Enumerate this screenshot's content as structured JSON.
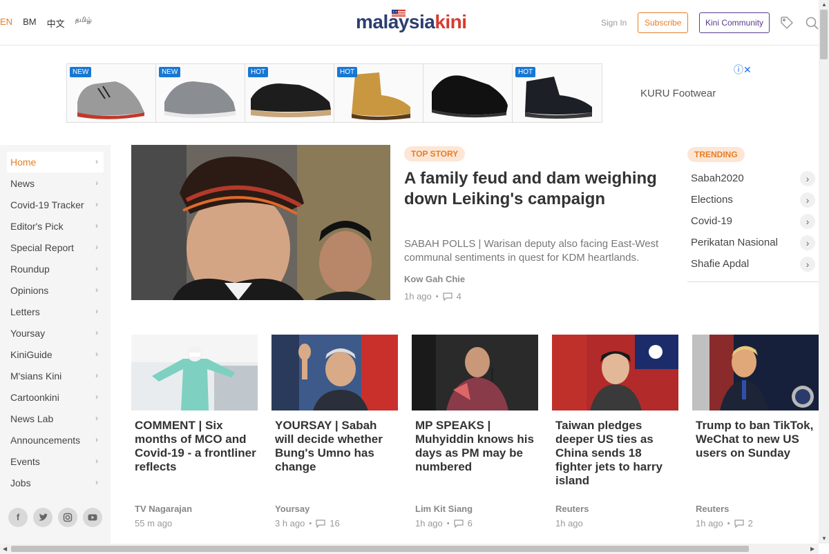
{
  "header": {
    "languages": [
      "EN",
      "BM",
      "中文",
      "தமிழ்"
    ],
    "logo_part1": "malaysia",
    "logo_part2": "kini",
    "sign_in": "Sign In",
    "subscribe": "Subscribe",
    "community": "Kini Community"
  },
  "ad": {
    "badges": [
      "NEW",
      "NEW",
      "HOT",
      "HOT",
      "",
      "HOT"
    ],
    "brand": "KURU Footwear"
  },
  "sidebar": {
    "items": [
      "Home",
      "News",
      "Covid-19 Tracker",
      "Editor's Pick",
      "Special Report",
      "Roundup",
      "Opinions",
      "Letters",
      "Yoursay",
      "KiniGuide",
      "M'sians Kini",
      "Cartoonkini",
      "News Lab",
      "Announcements",
      "Events",
      "Jobs"
    ],
    "social": [
      "f",
      "t",
      "ig",
      "yt"
    ]
  },
  "top_story": {
    "label": "TOP STORY",
    "title": "A family feud and dam weighing down Leiking's campaign",
    "desc": "SABAH POLLS | Warisan deputy also facing East-West communal sentiments in quest for KDM heartlands.",
    "author": "Kow Gah Chie",
    "time": "1h ago",
    "comments": "4"
  },
  "trending": {
    "label": "TRENDING",
    "items": [
      "Sabah2020",
      "Elections",
      "Covid-19",
      "Perikatan Nasional",
      "Shafie Apdal"
    ]
  },
  "cards": [
    {
      "title": "COMMENT | Six months of MCO and Covid-19 - a frontliner reflects",
      "author": "TV Nagarajan",
      "time": "55 m ago",
      "comments": ""
    },
    {
      "title": "YOURSAY | Sabah will decide whether Bung's Umno has change",
      "author": "Yoursay",
      "time": "3 h ago",
      "comments": "16"
    },
    {
      "title": "MP SPEAKS | Muhyiddin knows his days as PM may be numbered",
      "author": "Lim Kit Siang",
      "time": "1h ago",
      "comments": "6"
    },
    {
      "title": "Taiwan pledges deeper US ties as China sends 18 fighter jets to harry island",
      "author": "Reuters",
      "time": "1h ago",
      "comments": ""
    },
    {
      "title": "Trump to ban TikTok, WeChat to new US users on Sunday",
      "author": "Reuters",
      "time": "1h ago",
      "comments": "2"
    }
  ]
}
